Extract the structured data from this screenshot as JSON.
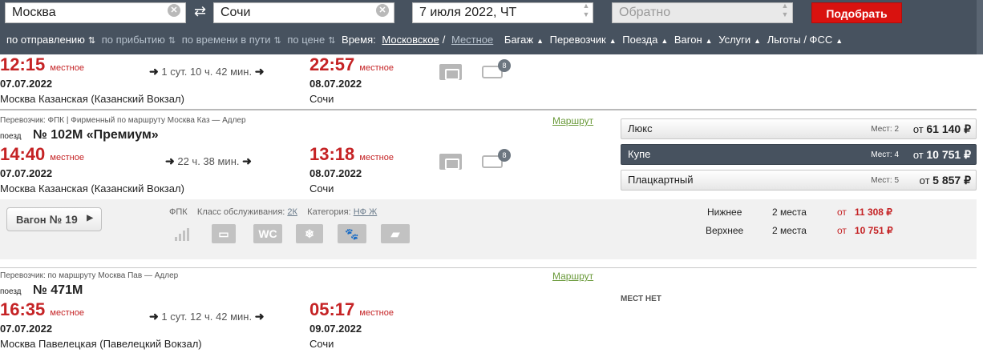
{
  "search": {
    "from": "Москва",
    "to": "Сочи",
    "date": "7 июля 2022, ЧТ",
    "return_placeholder": "Обратно",
    "submit_label": "Подобрать"
  },
  "filters": {
    "sort_departure": "по отправлению",
    "sort_arrival": "по прибытию",
    "sort_travel_time": "по времени в пути",
    "sort_price": "по цене",
    "time_label": "Время:",
    "time_moscow": "Московское",
    "time_separator": "/",
    "time_local": "Местное",
    "baggage": "Багаж",
    "carrier": "Перевозчик",
    "trains": "Поезда",
    "wagon": "Вагон",
    "services": "Услуги",
    "benefits": "Льготы / ФСС"
  },
  "trains": [
    {
      "dep_time": "12:15",
      "dep_tz": "местное",
      "dep_date": "07.07.2022",
      "dep_station": "Москва Казанская (Казанский Вокзал)",
      "duration": "1 сут. 10 ч. 42 мин.",
      "arr_time": "22:57",
      "arr_tz": "местное",
      "arr_date": "08.07.2022",
      "arr_station": "Сочи",
      "badge": "8"
    },
    {
      "carrier_line": "Перевозчик: ФПК | Фирменный   по маршруту Москва Каз — Адлер",
      "route_link": "Маршрут",
      "train_label": "поезд",
      "train_name": "№ 102М «Премиум»",
      "dep_time": "14:40",
      "dep_tz": "местное",
      "dep_date": "07.07.2022",
      "dep_station": "Москва Казанская (Казанский Вокзал)",
      "duration": "22 ч. 38 мин.",
      "arr_time": "13:18",
      "arr_tz": "местное",
      "arr_date": "08.07.2022",
      "arr_station": "Сочи",
      "badge": "8",
      "classes": [
        {
          "name": "Люкс",
          "seats": "Мест: 2",
          "from": "от",
          "price": "61 140 ₽"
        },
        {
          "name": "Купе",
          "seats": "Мест: 4",
          "from": "от",
          "price": "10 751 ₽"
        },
        {
          "name": "Плацкартный",
          "seats": "Мест: 5",
          "from": "от",
          "price": "5 857 ₽"
        }
      ],
      "car": {
        "wagon_label": "Вагон",
        "wagon_number": "№ 19",
        "carrier": "ФПК",
        "service_class_label": "Класс обслуживания:",
        "service_class": "2К",
        "category_label": "Категория:",
        "category": "НФ Ж",
        "wc_label": "WC",
        "seats": [
          {
            "type": "Нижнее",
            "count": "2 места",
            "from": "от",
            "price": "11 308 ₽"
          },
          {
            "type": "Верхнее",
            "count": "2 места",
            "from": "от",
            "price": "10 751 ₽"
          }
        ]
      }
    },
    {
      "carrier_line": "Перевозчик:   по маршруту Москва Пав — Адлер",
      "route_link": "Маршрут",
      "train_label": "поезд",
      "train_name": "№ 471М",
      "no_seats": "МЕСТ НЕТ",
      "dep_time": "16:35",
      "dep_tz": "местное",
      "dep_date": "07.07.2022",
      "dep_station": "Москва Павелецкая (Павелецкий Вокзал)",
      "duration": "1 сут. 12 ч. 42 мин.",
      "arr_time": "05:17",
      "arr_tz": "местное",
      "arr_date": "09.07.2022",
      "arr_station": "Сочи"
    }
  ]
}
